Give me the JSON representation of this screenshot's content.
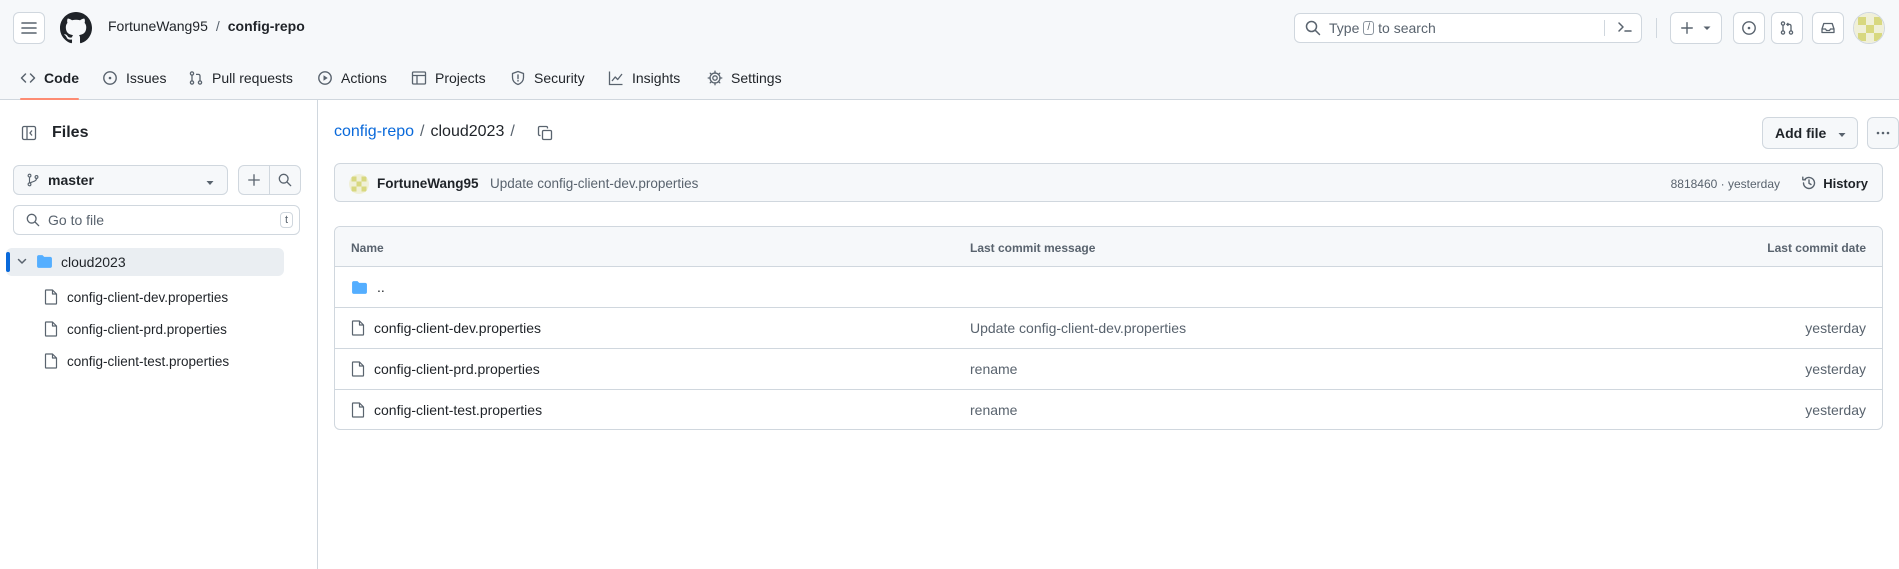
{
  "header": {
    "owner": "FortuneWang95",
    "separator": "/",
    "repo": "config-repo",
    "search_prefix": "Type",
    "search_key": "/",
    "search_suffix": "to search"
  },
  "tabs": [
    {
      "label": "Code",
      "icon": "code-icon",
      "active": true
    },
    {
      "label": "Issues",
      "icon": "issue-icon"
    },
    {
      "label": "Pull requests",
      "icon": "pull-request-icon"
    },
    {
      "label": "Actions",
      "icon": "play-icon"
    },
    {
      "label": "Projects",
      "icon": "table-icon"
    },
    {
      "label": "Security",
      "icon": "shield-icon"
    },
    {
      "label": "Insights",
      "icon": "graph-icon"
    },
    {
      "label": "Settings",
      "icon": "gear-icon"
    }
  ],
  "sidebar": {
    "title": "Files",
    "branch": "master",
    "goto_placeholder": "Go to file",
    "goto_key": "t",
    "tree": {
      "folder": "cloud2023",
      "files": [
        "config-client-dev.properties",
        "config-client-prd.properties",
        "config-client-test.properties"
      ]
    }
  },
  "main": {
    "path": {
      "root": "config-repo",
      "sep": "/",
      "current": "cloud2023",
      "trailing": "/"
    },
    "add_file": "Add file",
    "commit": {
      "author": "FortuneWang95",
      "message": "Update config-client-dev.properties",
      "meta": "8818460 · yesterday",
      "history": "History"
    },
    "table": {
      "headers": [
        "Name",
        "Last commit message",
        "Last commit date"
      ],
      "parent": "..",
      "rows": [
        {
          "name": "config-client-dev.properties",
          "message": "Update config-client-dev.properties",
          "date": "yesterday"
        },
        {
          "name": "config-client-prd.properties",
          "message": "rename",
          "date": "yesterday"
        },
        {
          "name": "config-client-test.properties",
          "message": "rename",
          "date": "yesterday"
        }
      ]
    }
  },
  "colors": {
    "accent": "#0969da",
    "tab_underline": "#fd8c73",
    "border": "#d0d7de",
    "muted": "#59636e",
    "folder": "#54aeff"
  }
}
